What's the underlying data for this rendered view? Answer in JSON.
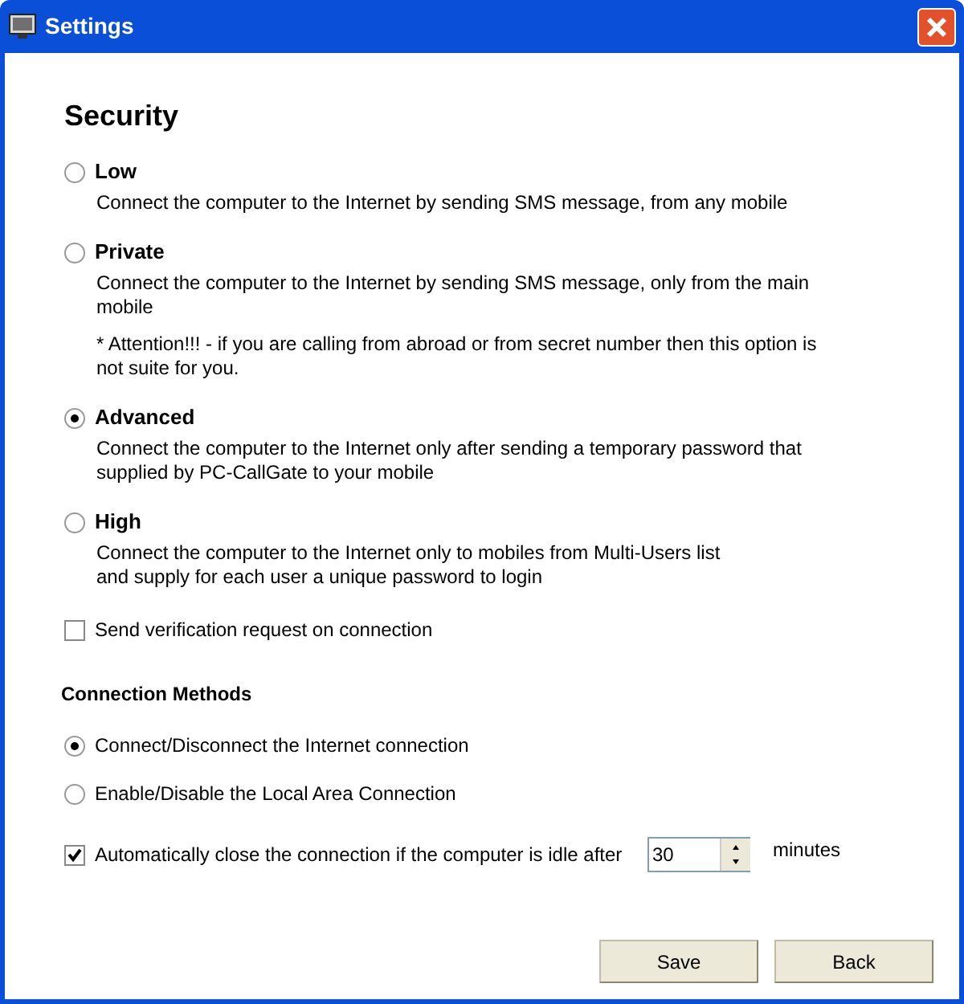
{
  "window": {
    "title": "Settings"
  },
  "security": {
    "heading": "Security",
    "options": [
      {
        "label": "Low",
        "selected": false,
        "description": "Connect the computer to the Internet by sending SMS message, from any mobile"
      },
      {
        "label": "Private",
        "selected": false,
        "description": "Connect the computer to the Internet by sending SMS message, only from the main mobile",
        "note": "* Attention!!! - if you are calling from abroad or from secret number then this option is not suite for you."
      },
      {
        "label": "Advanced",
        "selected": true,
        "description": "Connect the computer to the Internet only after sending a temporary password that supplied by PC-CallGate to your mobile"
      },
      {
        "label": "High",
        "selected": false,
        "description": "Connect the computer to the Internet only to mobiles from Multi-Users list\nand supply for each user a unique password to login"
      }
    ]
  },
  "verification": {
    "label": "Send verification request on connection",
    "checked": false
  },
  "connection_methods": {
    "heading": "Connection Methods",
    "options": [
      {
        "label": "Connect/Disconnect the Internet connection",
        "selected": true
      },
      {
        "label": "Enable/Disable the Local Area Connection",
        "selected": false
      }
    ]
  },
  "auto_close": {
    "label": "Automatically close the connection if the computer is idle after",
    "checked": true,
    "value": "30",
    "unit": "minutes"
  },
  "buttons": [
    "Save",
    "Back"
  ]
}
